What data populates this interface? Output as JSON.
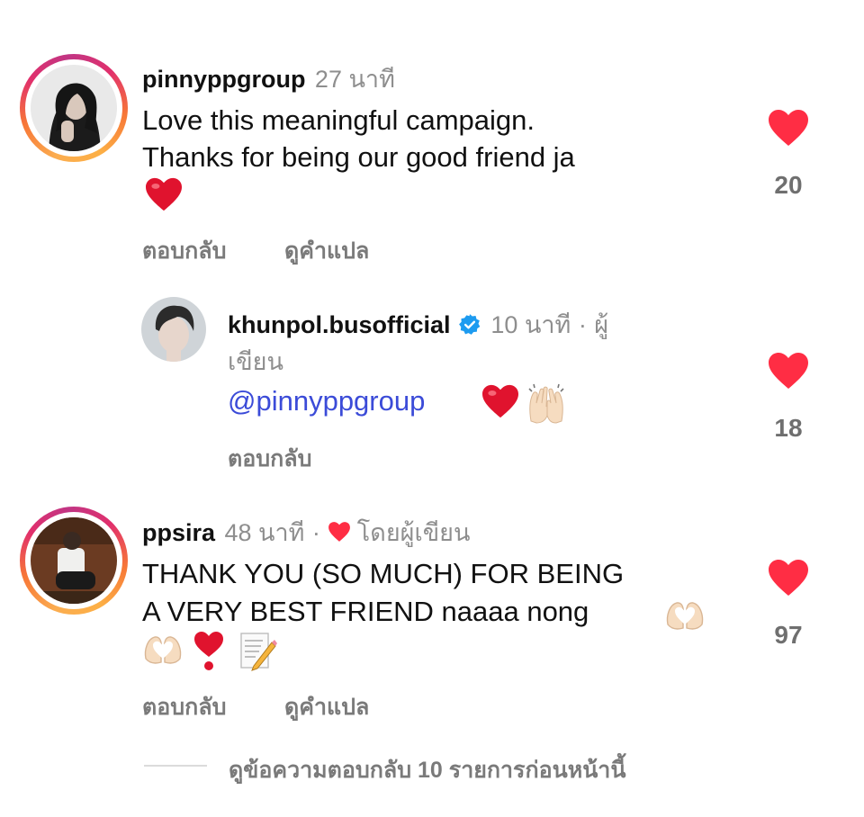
{
  "comments": [
    {
      "username": "pinnyppgroup",
      "time": "27 นาที",
      "lines": [
        "Love this meaningful campaign.",
        "Thanks for being our good friend ja"
      ],
      "reply_label": "ตอบกลับ",
      "translate_label": "ดูคำแปล",
      "likes": "20"
    },
    {
      "username": "khunpol.busofficial",
      "time": "10 นาที",
      "separator": "·",
      "author_label_line1": "ผู้",
      "author_label_line2": "เขียน",
      "mention": "@pinnyppgroup",
      "reply_label": "ตอบกลับ",
      "likes": "18"
    },
    {
      "username": "ppsira",
      "time": "48 นาที",
      "separator": "·",
      "liked_by_author": "โดยผู้เขียน",
      "lines": [
        "THANK YOU (SO MUCH) FOR BEING",
        "A VERY BEST FRIEND naaaa nong"
      ],
      "reply_label": "ตอบกลับ",
      "translate_label": "ดูคำแปล",
      "likes": "97"
    }
  ],
  "view_replies": "ดูข้อความตอบกลับ 10 รายการก่อนหน้านี้",
  "colors": {
    "heart": "#ff2d44",
    "mention": "#3b4bd8",
    "verified": "#1d9bf0"
  }
}
